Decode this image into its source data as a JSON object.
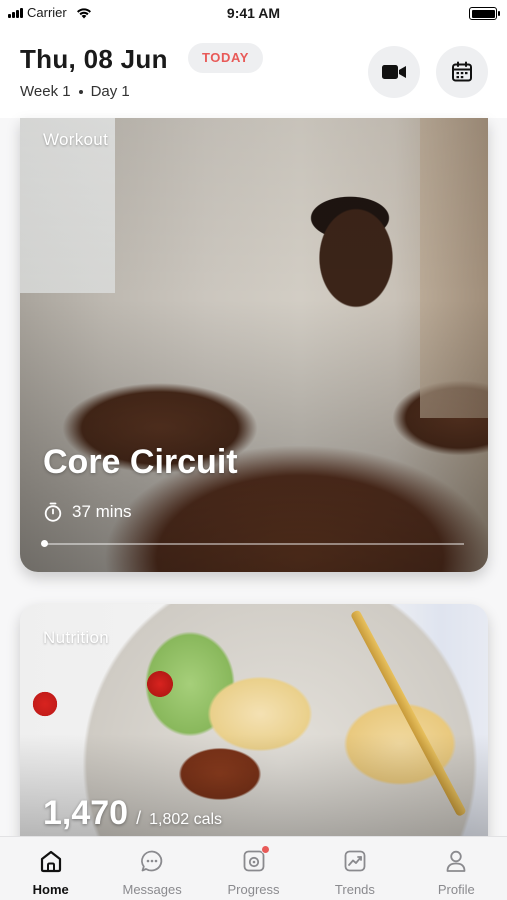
{
  "status_bar": {
    "carrier": "Carrier",
    "time": "9:41 AM",
    "signal_icon": "signal-icon",
    "wifi_icon": "wifi-icon",
    "battery_icon": "battery-icon"
  },
  "header": {
    "date": "Thu, 08 Jun",
    "today_badge": "TODAY",
    "week": "Week 1",
    "day": "Day 1",
    "video_button_icon": "video-camera-icon",
    "calendar_button_icon": "calendar-icon"
  },
  "workout": {
    "label": "Workout",
    "title": "Core Circuit",
    "duration": "37 mins",
    "timer_icon": "stopwatch-icon",
    "progress": 0.0
  },
  "nutrition": {
    "label": "Nutrition",
    "calories_consumed": "1,470",
    "separator": "/",
    "calories_goal": "1,802 cals"
  },
  "tab_bar": {
    "tabs": [
      {
        "label": "Home",
        "icon": "home-icon",
        "active": true
      },
      {
        "label": "Messages",
        "icon": "chat-bubble-icon",
        "active": false
      },
      {
        "label": "Progress",
        "icon": "progress-camera-icon",
        "active": false,
        "badge": true
      },
      {
        "label": "Trends",
        "icon": "trends-chart-icon",
        "active": false
      },
      {
        "label": "Profile",
        "icon": "profile-icon",
        "active": false
      }
    ]
  },
  "colors": {
    "accent": "#e85a58",
    "pill_bg": "#eeeff1",
    "active_tab": "#111111",
    "inactive_tab": "#8a8a8e"
  }
}
